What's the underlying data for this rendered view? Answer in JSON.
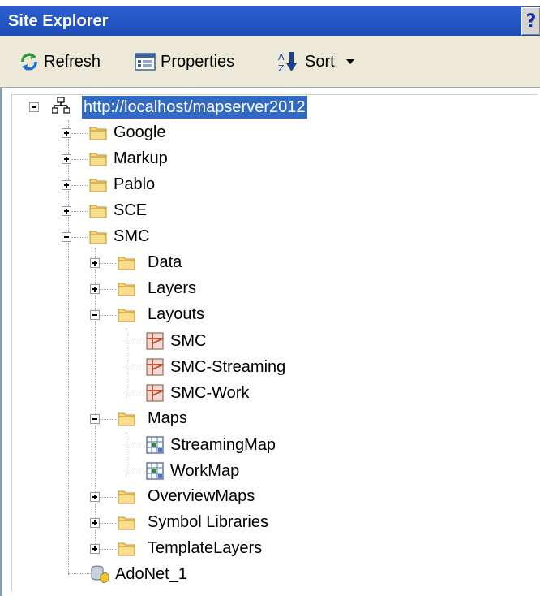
{
  "window": {
    "title": "Site Explorer",
    "help_glyph": "?"
  },
  "toolbar": {
    "refresh_label": "Refresh",
    "properties_label": "Properties",
    "sort_label": "Sort"
  },
  "tree": {
    "root": "http://localhost/mapserver2012",
    "items": {
      "google": "Google",
      "markup": "Markup",
      "pablo": "Pablo",
      "sce": "SCE",
      "smc": "SMC",
      "data": "Data",
      "layers": "Layers",
      "layouts": "Layouts",
      "layout_smc": "SMC",
      "layout_streaming": "SMC-Streaming",
      "layout_work": "SMC-Work",
      "maps": "Maps",
      "map_streaming": "StreamingMap",
      "map_work": "WorkMap",
      "overview": "OverviewMaps",
      "symbols": "Symbol Libraries",
      "template": "TemplateLayers",
      "adonet": "AdoNet_1"
    }
  },
  "colors": {
    "titlebar": "#2456c4",
    "selection": "#316ac5",
    "folder": "#f5d775",
    "toolbar_bg": "#ece9d8"
  }
}
